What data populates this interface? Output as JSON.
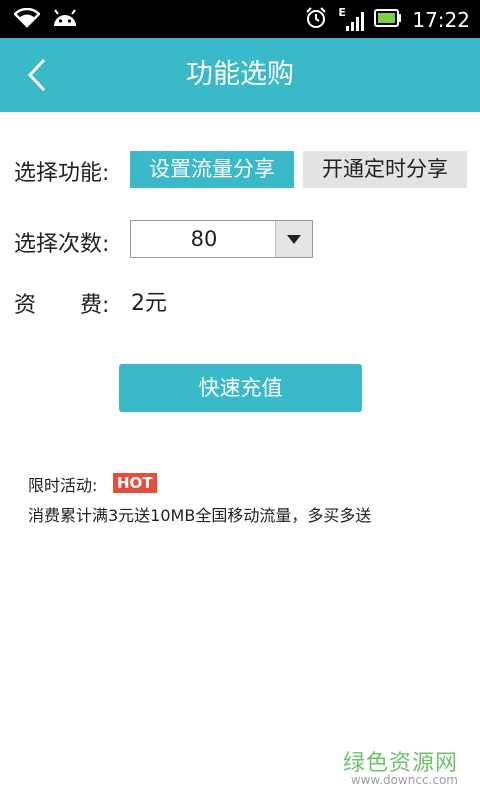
{
  "status_bar": {
    "time": "17:22",
    "network_type": "E",
    "icons": [
      "wifi-icon",
      "android-icon",
      "alarm-icon",
      "signal-icon",
      "battery-icon"
    ]
  },
  "header": {
    "title": "功能选购",
    "back_icon": "chevron-left-icon",
    "color": "#3ab9c8"
  },
  "function_select": {
    "label": "选择功能:",
    "options": [
      {
        "label": "设置流量分享",
        "selected": true
      },
      {
        "label": "开通定时分享",
        "selected": false
      }
    ]
  },
  "count_select": {
    "label": "选择次数:",
    "value": "80"
  },
  "fee": {
    "label_1": "资",
    "label_2": "费:",
    "value": "2元"
  },
  "charge_button": {
    "label": "快速充值"
  },
  "promotion": {
    "label": "限时活动:",
    "badge": "HOT",
    "badge_color": "#e2503b",
    "description": "消费累计满3元送10MB全国移动流量，多买多送"
  },
  "watermark": {
    "site_name": "绿色资源网",
    "url": "www.downcc.com"
  }
}
